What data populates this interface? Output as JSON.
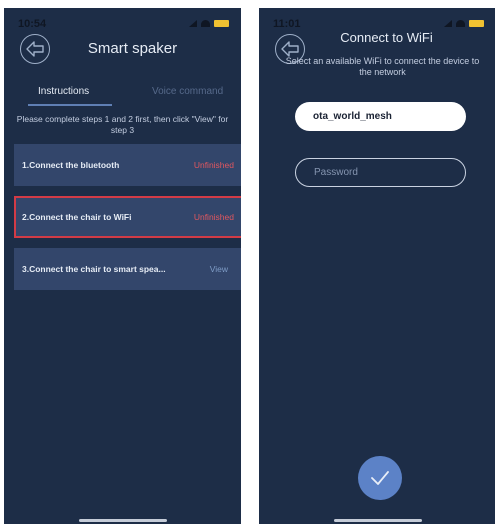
{
  "left_screen": {
    "status_time": "10:54",
    "title": "Smart spaker",
    "tabs": [
      {
        "label": "Instructions",
        "active": true
      },
      {
        "label": "Voice command",
        "active": false
      }
    ],
    "instruction_note": "Please complete steps 1 and 2 first, then click \"View\" for step 3",
    "steps": [
      {
        "label": "1.Connect the bluetooth",
        "status": "Unfinished"
      },
      {
        "label": "2.Connect the chair to WiFi",
        "status": "Unfinished",
        "highlighted": true
      },
      {
        "label": "3.Connect the chair to smart spea...",
        "status": "View"
      }
    ]
  },
  "right_screen": {
    "status_time": "11:01",
    "title": "Connect to WiFi",
    "subtitle": "Select an available WiFi to connect the device to the network",
    "ssid_value": "ota_world_mesh",
    "password_placeholder": "Password",
    "confirm_icon": "check-icon"
  },
  "colors": {
    "background": "#1d2d47",
    "card": "#33466b",
    "unfinished": "#e0575f",
    "highlight_border": "#d23b46",
    "confirm": "#5c82c7",
    "battery": "#f1c232"
  }
}
